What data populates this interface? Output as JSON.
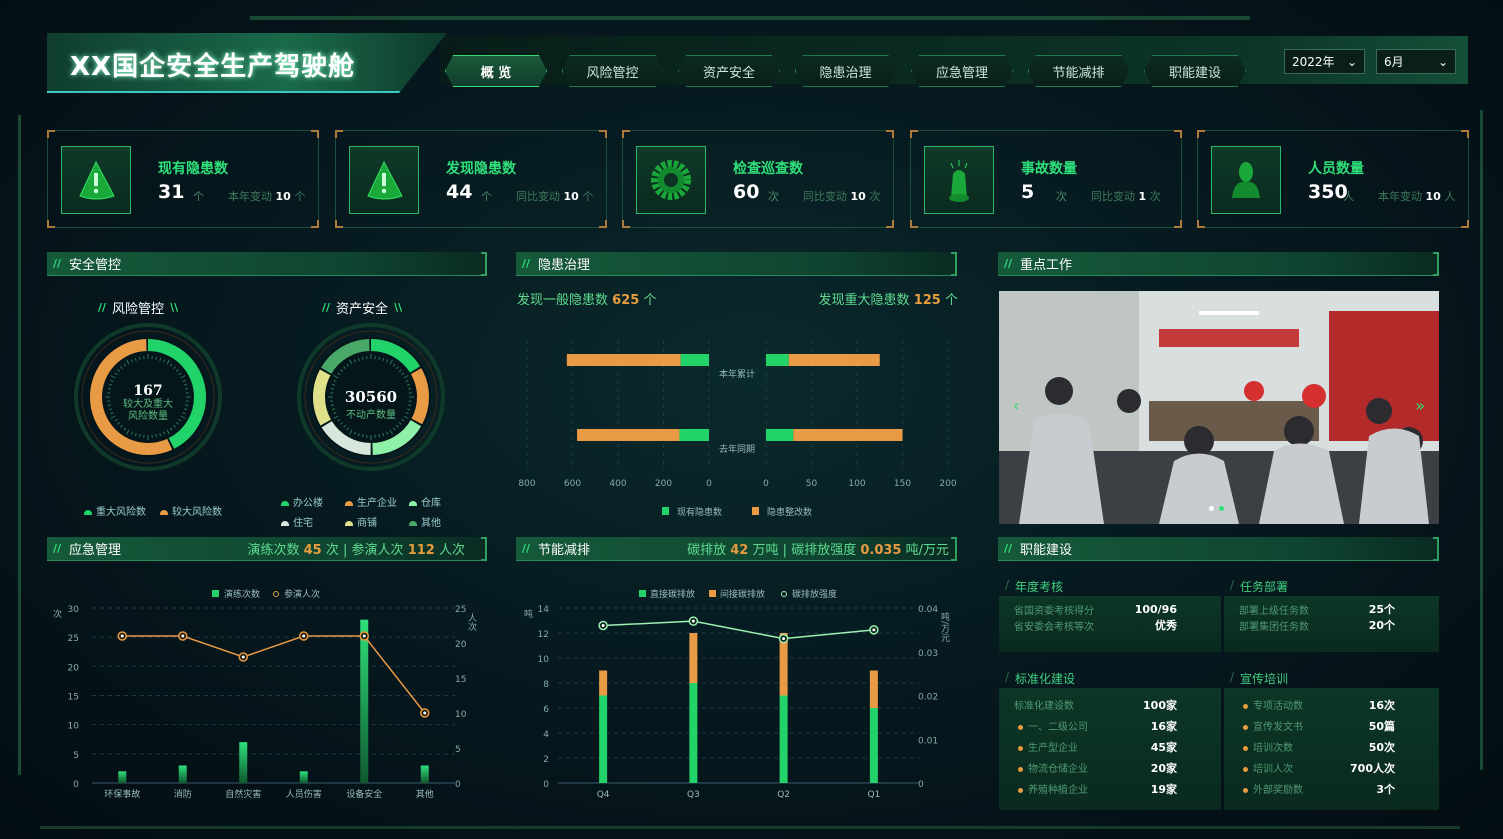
{
  "header": {
    "title": "XX国企安全生产驾驶舱"
  },
  "nav": {
    "tabs": [
      {
        "label": "概  览",
        "active": true
      },
      {
        "label": "风险管控"
      },
      {
        "label": "资产安全"
      },
      {
        "label": "隐患治理"
      },
      {
        "label": "应急管理"
      },
      {
        "label": "节能减排"
      },
      {
        "label": "职能建设"
      }
    ]
  },
  "filters": {
    "year": "2022年",
    "month": "6月"
  },
  "kpis": [
    {
      "title": "现有隐患数",
      "value": "31",
      "unit": "个",
      "change_label": "本年变动",
      "change": "10",
      "change_unit": "个",
      "icon": "warning-icon"
    },
    {
      "title": "发现隐患数",
      "value": "44",
      "unit": "个",
      "change_label": "同比变动",
      "change": "10",
      "change_unit": "个",
      "icon": "warning-icon"
    },
    {
      "title": "检查巡查数",
      "value": "60",
      "unit": "次",
      "change_label": "同比变动",
      "change": "10",
      "change_unit": "次",
      "icon": "gear-icon"
    },
    {
      "title": "事故数量",
      "value": "5",
      "unit": "次",
      "change_label": "同比变动",
      "change": "1",
      "change_unit": "次",
      "icon": "alarm-light-icon"
    },
    {
      "title": "人员数量",
      "value": "350",
      "unit": "人",
      "change_label": "本年变动",
      "change": "10",
      "change_unit": "人",
      "icon": "person-icon"
    }
  ],
  "safety": {
    "title": "安全管控",
    "risk": {
      "title": "风险管控",
      "value": "167",
      "label1": "较大及重大",
      "label2": "风险数量",
      "legend": [
        "重大风险数",
        "较大风险数"
      ]
    },
    "asset": {
      "title": "资产安全",
      "value": "30560",
      "label": "不动产数量",
      "legend": [
        "办公楼",
        "生产企业",
        "仓库",
        "住宅",
        "商铺",
        "其他"
      ]
    }
  },
  "hazard": {
    "title": "隐患治理",
    "general_label": "发现一般隐患数",
    "general_value": "625",
    "general_unit": "个",
    "major_label": "发现重大隐患数",
    "major_value": "125",
    "major_unit": "个"
  },
  "key_work": {
    "title": "重点工作"
  },
  "emergency": {
    "title": "应急管理",
    "drills_label": "演练次数",
    "drills_value": "45",
    "drills_unit": "次",
    "sep": "|",
    "people_label": "参演人次",
    "people_value": "112",
    "people_unit": "人次"
  },
  "energy": {
    "title": "节能减排",
    "carbon_label": "碳排放",
    "carbon_value": "42",
    "carbon_unit": "万吨",
    "sep": "|",
    "intensity_label": "碳排放强度",
    "intensity_value": "0.035",
    "intensity_unit": "吨/万元"
  },
  "functions": {
    "title": "职能建设",
    "annual": {
      "title": "年度考核",
      "rows": [
        {
          "label": "省国资委考核得分",
          "value": "100/96"
        },
        {
          "label": "省安委会考核等次",
          "value": "优秀"
        }
      ]
    },
    "tasks": {
      "title": "任务部署",
      "rows": [
        {
          "label": "部署上级任务数",
          "value": "25个"
        },
        {
          "label": "部署集团任务数",
          "value": "20个"
        }
      ]
    },
    "standard": {
      "title": "标准化建设",
      "rows": [
        {
          "label": "标准化建设数",
          "value": "100家"
        },
        {
          "label": "一、二级公司",
          "value": "16家"
        },
        {
          "label": "生产型企业",
          "value": "45家"
        },
        {
          "label": "物流仓储企业",
          "value": "20家"
        },
        {
          "label": "养殖种植企业",
          "value": "19家"
        }
      ]
    },
    "training": {
      "title": "宣传培训",
      "rows": [
        {
          "label": "专项活动数",
          "value": "16次"
        },
        {
          "label": "宣传发文书",
          "value": "50篇"
        },
        {
          "label": "培训次数",
          "value": "50次"
        },
        {
          "label": "培训人次",
          "value": "700人次"
        },
        {
          "label": "外部奖励数",
          "value": "3个"
        }
      ]
    }
  },
  "colors": {
    "green": "#22d36a",
    "orange": "#e99a45",
    "lightgreen": "#8ff0a8",
    "white": "#d8e6dc",
    "yellow": "#e0e08a",
    "darkgreen": "#4aa868"
  },
  "chart_data": [
    {
      "id": "risk",
      "type": "pie",
      "title": "风险管控",
      "categories": [
        "重大风险数",
        "较大风险数"
      ],
      "values": [
        72,
        95
      ],
      "colors": [
        "#22d36a",
        "#e99a45"
      ]
    },
    {
      "id": "asset",
      "type": "pie",
      "title": "资产安全",
      "categories": [
        "办公楼",
        "生产企业",
        "仓库",
        "住宅",
        "商铺",
        "其他"
      ],
      "values": [
        5100,
        5100,
        5100,
        5100,
        5080,
        5080
      ],
      "colors": [
        "#22d36a",
        "#e99a45",
        "#8ff0a8",
        "#d8e6dc",
        "#e0e08a",
        "#4aa868"
      ]
    },
    {
      "id": "hazard",
      "type": "bar",
      "orientation": "horizontal-stacked-mirror",
      "categories": [
        "本年累计",
        "去年同期"
      ],
      "left": {
        "xlim": [
          0,
          800
        ],
        "ticks": [
          "800",
          "600",
          "400",
          "200",
          "0"
        ],
        "series": [
          {
            "name": "现有隐患数",
            "values": [
              125,
              130
            ]
          },
          {
            "name": "隐患整改数",
            "values": [
              500,
              450
            ]
          }
        ]
      },
      "right": {
        "xlim": [
          0,
          200
        ],
        "ticks": [
          "0",
          "50",
          "100",
          "150",
          "200"
        ],
        "series": [
          {
            "name": "现有隐患数",
            "values": [
              25,
              30
            ]
          },
          {
            "name": "隐患整改数",
            "values": [
              100,
              120
            ]
          }
        ]
      },
      "legend": [
        "现有隐患数",
        "隐患整改数"
      ]
    },
    {
      "id": "emergency",
      "type": "bar",
      "categories": [
        "环保事故",
        "消防",
        "自然灾害",
        "人员伤害",
        "设备安全",
        "其他"
      ],
      "series": [
        {
          "name": "演练次数",
          "type": "bar",
          "axis": "left",
          "values": [
            2,
            3,
            7,
            2,
            28,
            3
          ]
        },
        {
          "name": "参演人次",
          "type": "line",
          "axis": "right",
          "values": [
            21,
            21,
            18,
            21,
            21,
            10
          ]
        }
      ],
      "ylabel": "次",
      "y2label": "人次",
      "ylim": [
        0,
        30
      ],
      "y2lim": [
        0,
        25
      ],
      "yticks": [
        "0",
        "5",
        "10",
        "15",
        "20",
        "25",
        "30"
      ],
      "y2ticks": [
        "0",
        "5",
        "10",
        "15",
        "20",
        "25"
      ]
    },
    {
      "id": "energy",
      "type": "bar",
      "stacked": true,
      "categories": [
        "Q4",
        "Q3",
        "Q2",
        "Q1"
      ],
      "series": [
        {
          "name": "直接碳排放",
          "type": "bar",
          "values": [
            7,
            8,
            7,
            6
          ]
        },
        {
          "name": "间接碳排放",
          "type": "bar",
          "values": [
            2,
            4,
            5,
            3
          ]
        },
        {
          "name": "碳排放强度",
          "type": "line",
          "axis": "right",
          "values": [
            0.036,
            0.037,
            0.033,
            0.035
          ]
        }
      ],
      "ylabel": "吨",
      "y2label": "吨/万元",
      "ylim": [
        0,
        14
      ],
      "y2lim": [
        0,
        0.04
      ],
      "yticks": [
        "0",
        "2",
        "4",
        "6",
        "8",
        "10",
        "12",
        "14"
      ],
      "y2ticks": [
        "0",
        "0.01",
        "0.02",
        "0.03",
        "0.04"
      ]
    }
  ]
}
